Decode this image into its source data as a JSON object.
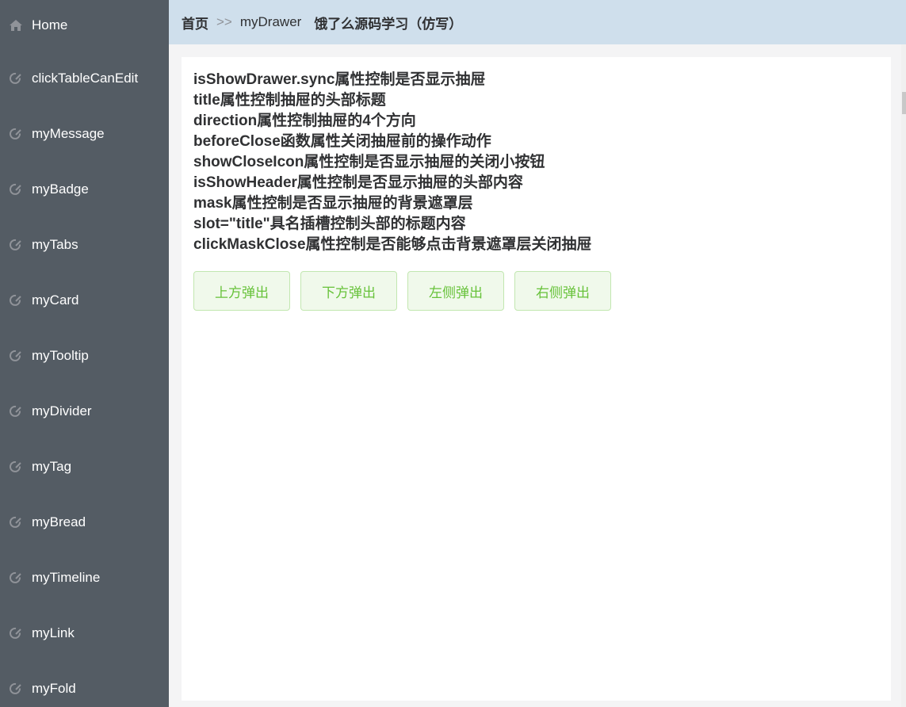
{
  "sidebar": {
    "items": [
      {
        "label": "Home",
        "icon": "home-icon"
      },
      {
        "label": "clickTableCanEdit",
        "icon": "edit-icon"
      },
      {
        "label": "myMessage",
        "icon": "edit-icon"
      },
      {
        "label": "myBadge",
        "icon": "edit-icon"
      },
      {
        "label": "myTabs",
        "icon": "edit-icon"
      },
      {
        "label": "myCard",
        "icon": "edit-icon"
      },
      {
        "label": "myTooltip",
        "icon": "edit-icon"
      },
      {
        "label": "myDivider",
        "icon": "edit-icon"
      },
      {
        "label": "myTag",
        "icon": "edit-icon"
      },
      {
        "label": "myBread",
        "icon": "edit-icon"
      },
      {
        "label": "myTimeline",
        "icon": "edit-icon"
      },
      {
        "label": "myLink",
        "icon": "edit-icon"
      },
      {
        "label": "myFold",
        "icon": "edit-icon"
      }
    ],
    "background": "#545c64"
  },
  "header": {
    "home": "首页",
    "separator": ">>",
    "current": "myDrawer",
    "extra": "饿了么源码学习（仿写）",
    "background": "#cfdfec"
  },
  "main": {
    "lines": [
      "isShowDrawer.sync属性控制是否显示抽屉",
      "title属性控制抽屉的头部标题",
      "direction属性控制抽屉的4个方向",
      "beforeClose函数属性关闭抽屉前的操作动作",
      "showCloseIcon属性控制是否显示抽屉的关闭小按钮",
      "isShowHeader属性控制是否显示抽屉的头部内容",
      "mask属性控制是否显示抽屉的背景遮罩层",
      "slot=\"title\"具名插槽控制头部的标题内容",
      "clickMaskClose属性控制是否能够点击背景遮罩层关闭抽屉"
    ],
    "buttons": {
      "top": "上方弹出",
      "bottom": "下方弹出",
      "left": "左侧弹出",
      "right": "右侧弹出"
    },
    "button_color": "#67c23a"
  }
}
